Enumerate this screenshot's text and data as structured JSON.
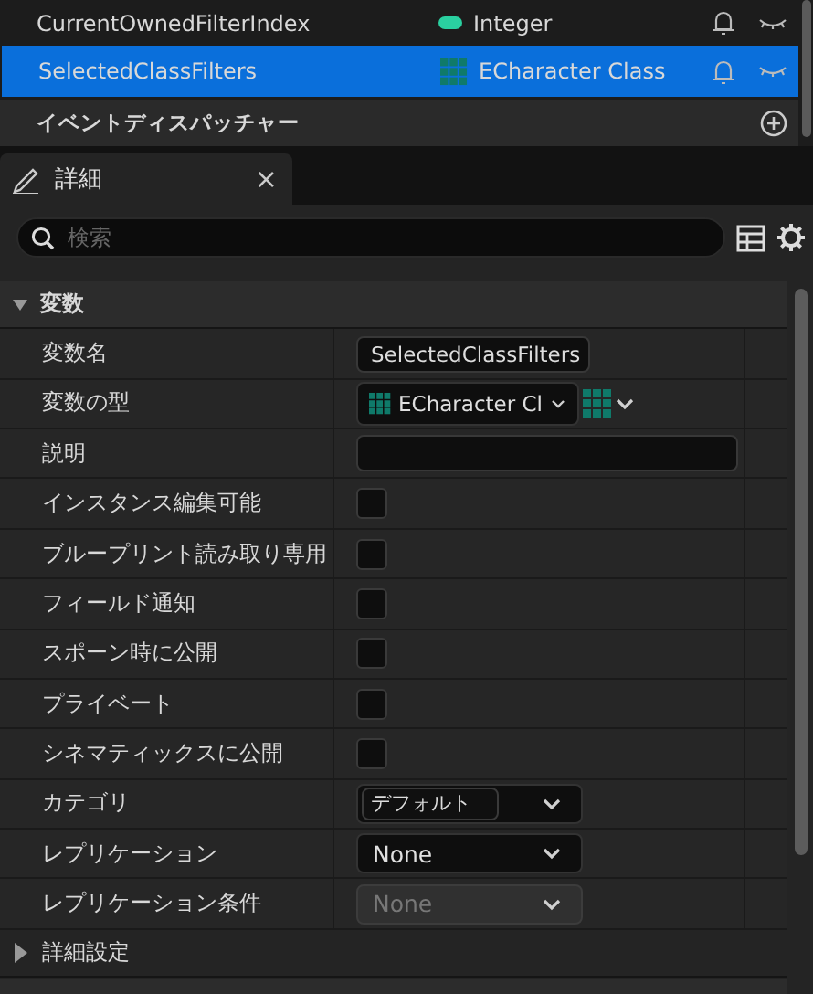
{
  "variables": [
    {
      "name": "CurrentOwnedFilterIndex",
      "type": "Integer",
      "kind": "pill",
      "selected": false
    },
    {
      "name": "SelectedClassFilters",
      "type": "ECharacter Class",
      "kind": "grid",
      "selected": true
    }
  ],
  "dispatcher_header": "イベントディスパッチャー",
  "details_tab": {
    "title": "詳細",
    "close": "×"
  },
  "search": {
    "placeholder": "検索"
  },
  "section": {
    "title": "変数",
    "expanded": true
  },
  "properties": [
    {
      "label": "変数名",
      "kind": "text",
      "value": "SelectedClassFilters"
    },
    {
      "label": "変数の型",
      "kind": "type",
      "value": "ECharacter Cl"
    },
    {
      "label": "説明",
      "kind": "textarea"
    },
    {
      "label": "インスタンス編集可能",
      "kind": "checkbox",
      "checked": false
    },
    {
      "label": "ブループリント読み取り専用",
      "kind": "checkbox",
      "checked": false
    },
    {
      "label": "フィールド通知",
      "kind": "checkbox",
      "checked": false
    },
    {
      "label": "スポーン時に公開",
      "kind": "checkbox",
      "checked": false
    },
    {
      "label": "プライベート",
      "kind": "checkbox",
      "checked": false
    },
    {
      "label": "シネマティックスに公開",
      "kind": "checkbox",
      "checked": false
    },
    {
      "label": "カテゴリ",
      "kind": "combo",
      "value": "デフォルト"
    },
    {
      "label": "レプリケーション",
      "kind": "dropdown",
      "value": "None",
      "disabled": false
    },
    {
      "label": "レプリケーション条件",
      "kind": "dropdown",
      "value": "None",
      "disabled": true
    }
  ],
  "advanced_section": {
    "title": "詳細設定",
    "expanded": false
  }
}
